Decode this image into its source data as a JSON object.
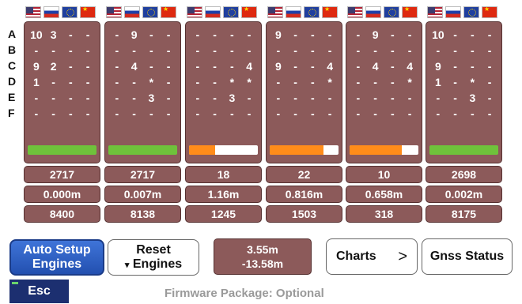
{
  "row_labels": [
    "A",
    "B",
    "C",
    "D",
    "E",
    "F"
  ],
  "columns": [
    {
      "grid": [
        [
          "10",
          "3",
          "-",
          "-"
        ],
        [
          "-",
          "-",
          "-",
          "-"
        ],
        [
          "9",
          "2",
          "-",
          "-"
        ],
        [
          "1",
          "-",
          "-",
          "-"
        ],
        [
          "-",
          "-",
          "-",
          "-"
        ],
        [
          "-",
          "-",
          "-",
          "-"
        ]
      ],
      "bar": {
        "fraction": 1.0,
        "color": "#6fc23b"
      },
      "count": "2717",
      "distance": "0.000m",
      "value": "8400"
    },
    {
      "grid": [
        [
          "-",
          "9",
          "-",
          "-"
        ],
        [
          "-",
          "-",
          "-",
          "-"
        ],
        [
          "-",
          "4",
          "-",
          "-"
        ],
        [
          "-",
          "-",
          "*",
          "-"
        ],
        [
          "-",
          "-",
          "3",
          "-"
        ],
        [
          "-",
          "-",
          "-",
          "-"
        ]
      ],
      "bar": {
        "fraction": 1.0,
        "color": "#6fc23b"
      },
      "count": "2717",
      "distance": "0.007m",
      "value": "8138"
    },
    {
      "grid": [
        [
          "-",
          "-",
          "-",
          "-"
        ],
        [
          "-",
          "-",
          "-",
          "-"
        ],
        [
          "-",
          "-",
          "-",
          "4"
        ],
        [
          "-",
          "-",
          "*",
          "*"
        ],
        [
          "-",
          "-",
          "3",
          "-"
        ],
        [
          "-",
          "-",
          "-",
          "-"
        ]
      ],
      "bar": {
        "fraction": 0.38,
        "color": "#ff8c1a"
      },
      "count": "18",
      "distance": "1.16m",
      "value": "1245"
    },
    {
      "grid": [
        [
          "9",
          "-",
          "-",
          "-"
        ],
        [
          "-",
          "-",
          "-",
          "-"
        ],
        [
          "9",
          "-",
          "-",
          "4"
        ],
        [
          "-",
          "-",
          "-",
          "*"
        ],
        [
          "-",
          "-",
          "-",
          "-"
        ],
        [
          "-",
          "-",
          "-",
          "-"
        ]
      ],
      "bar": {
        "fraction": 0.78,
        "color": "#ff8c1a"
      },
      "count": "22",
      "distance": "0.816m",
      "value": "1503"
    },
    {
      "grid": [
        [
          "-",
          "9",
          "-",
          "-"
        ],
        [
          "-",
          "-",
          "-",
          "-"
        ],
        [
          "-",
          "4",
          "-",
          "4"
        ],
        [
          "-",
          "-",
          "-",
          "*"
        ],
        [
          "-",
          "-",
          "-",
          "-"
        ],
        [
          "-",
          "-",
          "-",
          "-"
        ]
      ],
      "bar": {
        "fraction": 0.76,
        "color": "#ff8c1a"
      },
      "count": "10",
      "distance": "0.658m",
      "value": "318"
    },
    {
      "grid": [
        [
          "10",
          "-",
          "-",
          "-"
        ],
        [
          "-",
          "-",
          "-",
          "-"
        ],
        [
          "9",
          "-",
          "-",
          "-"
        ],
        [
          "1",
          "-",
          "*",
          "-"
        ],
        [
          "-",
          "-",
          "3",
          "-"
        ],
        [
          "-",
          "-",
          "-",
          "-"
        ]
      ],
      "bar": {
        "fraction": 1.0,
        "color": "#6fc23b"
      },
      "count": "2698",
      "distance": "0.002m",
      "value": "8175"
    }
  ],
  "buttons": {
    "auto_setup_line1": "Auto Setup",
    "auto_setup_line2": "Engines",
    "reset_line1": "Reset",
    "reset_line2": "Engines",
    "reset_arrow": "▾",
    "charts": "Charts",
    "charts_arrow": ">",
    "gnss": "Gnss Status",
    "esc": "Esc"
  },
  "position": {
    "line1": "3.55m",
    "line2": "-13.58m"
  },
  "footer": {
    "firmware": "Firmware Package: Optional"
  }
}
